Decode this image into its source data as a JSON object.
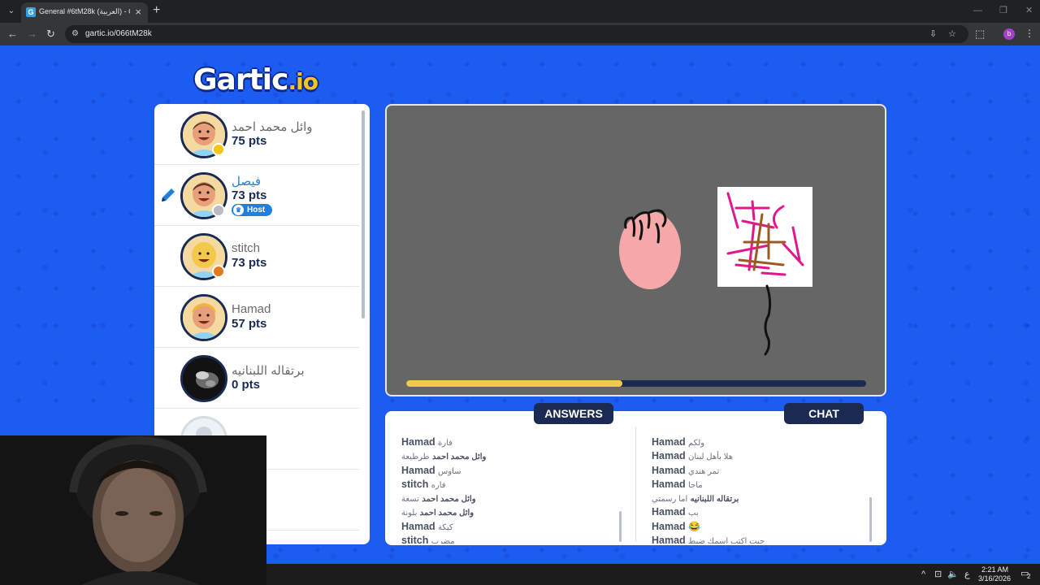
{
  "browser": {
    "tab_title": "General #6tM28k (العربية) - Gar",
    "favicon_letter": "G",
    "url": "gartic.io/066tM28k",
    "profile_letter": "b"
  },
  "logo": {
    "main": "Gartic",
    "suffix": ".io"
  },
  "players": [
    {
      "name": "وائل محمد احمد",
      "points": "75 pts",
      "status_color": "#f5c51d",
      "skin": "#e9a07a",
      "hair": "#5a3b28",
      "shirt": "#8fd4f5",
      "drawing": false,
      "host": false
    },
    {
      "name": "فيصل",
      "points": "73 pts",
      "status_color": "#b8bcc2",
      "skin": "#e9a07a",
      "hair": "#5a3b28",
      "shirt": "#8fd4f5",
      "drawing": true,
      "host": true,
      "host_label": "Host",
      "name_color": "#1f80e0"
    },
    {
      "name": "stitch",
      "points": "73 pts",
      "status_color": "#e07a1a",
      "skin": "#f4c84a",
      "hair": "#f4c84a",
      "shirt": "#8fd4f5",
      "drawing": false,
      "host": false
    },
    {
      "name": "Hamad",
      "points": "57 pts",
      "status_color": "",
      "skin": "#e9a07a",
      "hair": "#f2b53a",
      "shirt": "#8fd4f5",
      "drawing": false,
      "host": false
    },
    {
      "name": "برتقاله اللبنانيه",
      "points": "0 pts",
      "status_color": "",
      "skin": "",
      "hair": "",
      "shirt": "",
      "drawing": false,
      "host": false
    }
  ],
  "canvas": {
    "timer_progress": 0.47,
    "timer_color": "#f2c94c"
  },
  "answers": {
    "title": "ANSWERS",
    "messages": [
      {
        "user": "Hamad",
        "text": "فارة"
      },
      {
        "user": "وائل محمد احمد",
        "text": "طرطيعة"
      },
      {
        "user": "Hamad",
        "text": "ساوس"
      },
      {
        "user": "stitch",
        "text": "فاره"
      },
      {
        "user": "وائل محمد احمد",
        "text": "تسعة"
      },
      {
        "user": "وائل محمد احمد",
        "text": "بلونة"
      },
      {
        "user": "Hamad",
        "text": "كيكة"
      },
      {
        "user": "stitch",
        "text": "مضرب"
      }
    ]
  },
  "chat": {
    "title": "CHAT",
    "messages": [
      {
        "user": "Hamad",
        "text": "ولكم"
      },
      {
        "user": "Hamad",
        "text": "هلا بأهل لبنان"
      },
      {
        "user": "Hamad",
        "text": "تمر هندي"
      },
      {
        "user": "Hamad",
        "text": "ماجا"
      },
      {
        "user": "برتقاله اللبنانيه",
        "text": "اما رسمتي"
      },
      {
        "user": "Hamad",
        "text": "بب"
      },
      {
        "user": "Hamad",
        "text": "😂"
      },
      {
        "user": "Hamad",
        "text": "جيت اكتب اسمك ضبط"
      }
    ]
  },
  "taskbar": {
    "time": "2:21 AM",
    "date": "3/16/2026",
    "lang": "ع",
    "notification_count": "2"
  },
  "colors": {
    "page_bg": "#1d5cf2",
    "navy": "#1a2a52",
    "host_blue": "#1f80e0"
  }
}
